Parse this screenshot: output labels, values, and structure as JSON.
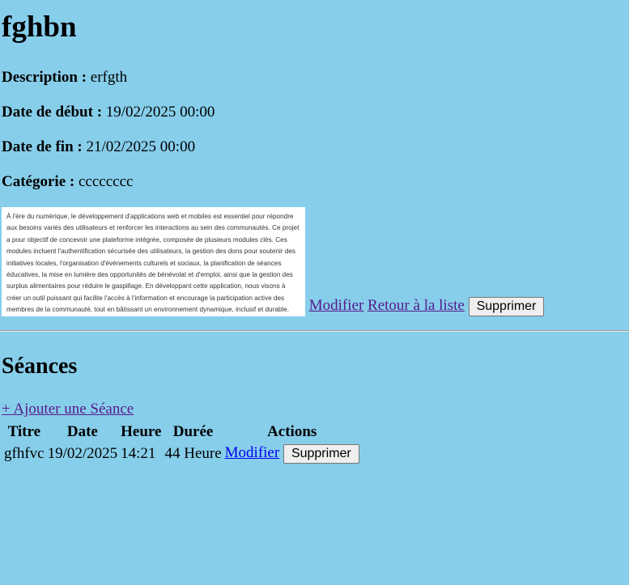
{
  "event": {
    "title": "fghbn",
    "description_label": "Description :",
    "description": "erfgth",
    "start_label": "Date de début :",
    "start": "19/02/2025 00:00",
    "end_label": "Date de fin :",
    "end": "21/02/2025 00:00",
    "category_label": "Catégorie :",
    "category": "cccccccc",
    "image_text": "À l'ère du numérique, le développement d'applications web et mobiles est essentiel pour répondre aux besoins variés des utilisateurs et renforcer les interactions au sein des communautés. Ce projet a pour objectif de concevoir une plateforme intégrée, composée de plusieurs modules clés. Ces modules incluent l'authentification sécurisée des utilisateurs, la gestion des dons pour soutenir des initiatives locales, l'organisation d'événements culturels et sociaux, la planification de séances éducatives, la mise en lumière des opportunités de bénévolat et d'emploi, ainsi que la gestion des surplus alimentaires pour réduire le gaspillage. En développant cette application, nous visons à créer un outil puissant qui facilite l'accès à l'information et encourage la participation active des membres de la communauté, tout en bâtissant un environnement dynamique, inclusif et durable.",
    "edit_label": "Modifier",
    "back_label": "Retour à la liste",
    "delete_label": "Supprimer"
  },
  "seances": {
    "heading": "Séances",
    "add_label": "+ Ajouter une Séance",
    "columns": [
      "Titre",
      "Date",
      "Heure",
      "Durée",
      "Actions"
    ],
    "rows": [
      {
        "titre": "gfhfvc",
        "date": "19/02/2025",
        "heure": "14:21",
        "duree": "44 Heure",
        "edit_label": "Modifier",
        "delete_label": "Supprimer"
      }
    ]
  }
}
